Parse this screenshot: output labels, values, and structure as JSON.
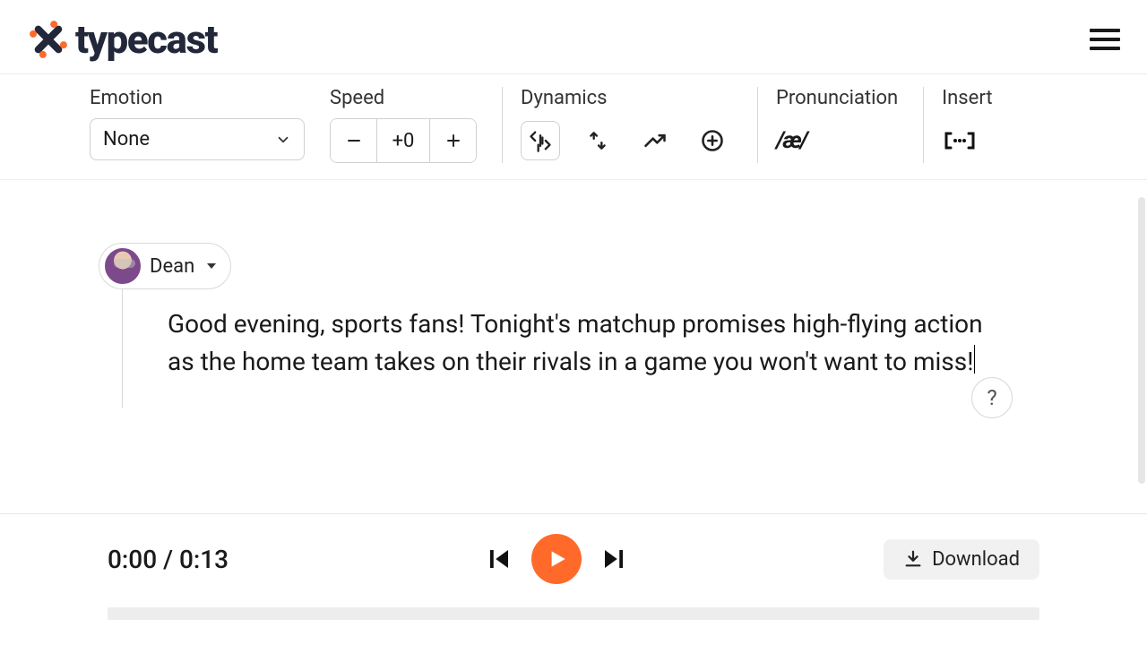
{
  "brand": {
    "name": "typecast"
  },
  "toolbar": {
    "emotion": {
      "label": "Emotion",
      "value": "None"
    },
    "speed": {
      "label": "Speed",
      "value": "+0"
    },
    "dynamics": {
      "label": "Dynamics"
    },
    "pronunciation": {
      "label": "Pronunciation",
      "symbol": "/æ/"
    },
    "insert": {
      "label": "Insert"
    }
  },
  "voice": {
    "name": "Dean"
  },
  "script": {
    "text": "Good evening, sports fans! Tonight's matchup promises high-flying action as the home team takes on their rivals in a game you won't want to miss!"
  },
  "help": {
    "label": "?"
  },
  "player": {
    "current": "0:00",
    "duration": "0:13",
    "download": "Download"
  }
}
